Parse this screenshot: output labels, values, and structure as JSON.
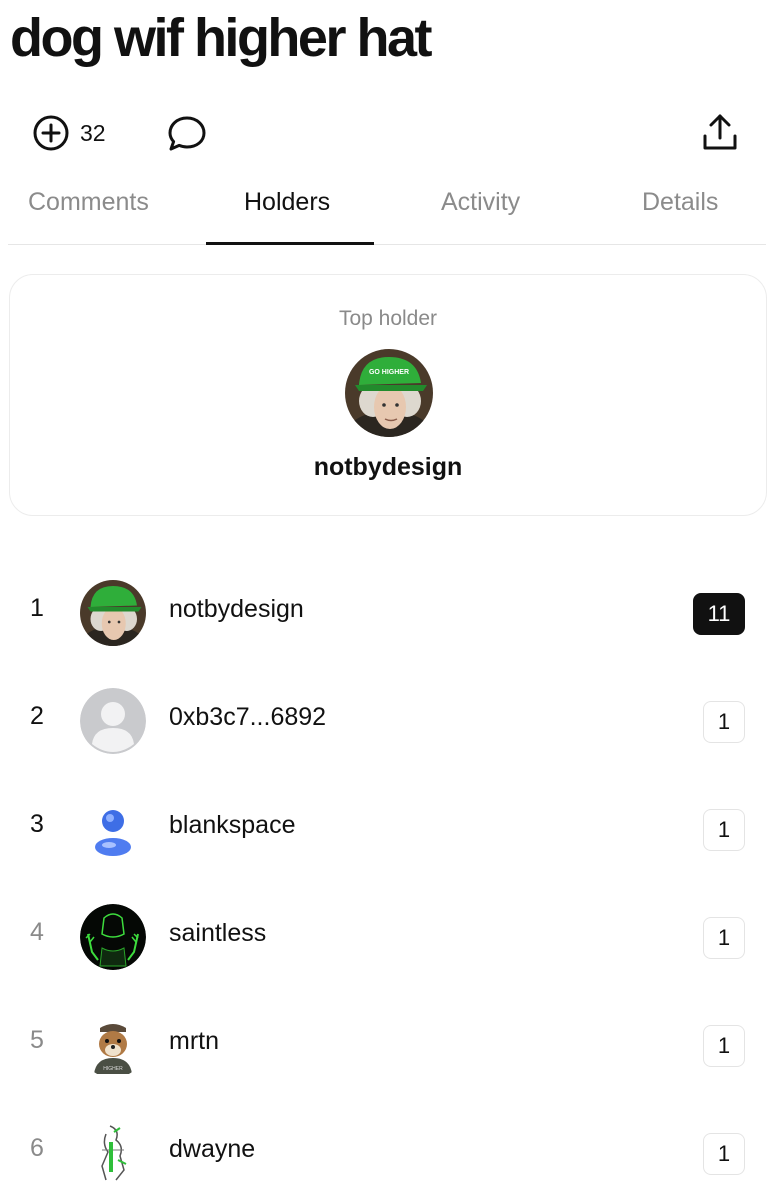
{
  "page": {
    "title": "dog wif higher hat"
  },
  "actions": {
    "mint_count": "32"
  },
  "tabs": [
    {
      "label": "Comments"
    },
    {
      "label": "Holders"
    },
    {
      "label": "Activity"
    },
    {
      "label": "Details"
    }
  ],
  "active_tab": "Holders",
  "top_holder": {
    "label": "Top holder",
    "name": "notbydesign",
    "avatar_caption": "GO HIGHER"
  },
  "holders": [
    {
      "rank": "1",
      "name": "notbydesign",
      "count": "11",
      "avatar": "green-cap-portrait"
    },
    {
      "rank": "2",
      "name": "0xb3c7...6892",
      "count": "1",
      "avatar": "default-gray-avatar"
    },
    {
      "rank": "3",
      "name": "blankspace",
      "count": "1",
      "avatar": "blue-person-avatar"
    },
    {
      "rank": "4",
      "name": "saintless",
      "count": "1",
      "avatar": "neon-green-figure"
    },
    {
      "rank": "5",
      "name": "mrtn",
      "count": "1",
      "avatar": "dog-with-cap"
    },
    {
      "rank": "6",
      "name": "dwayne",
      "count": "1",
      "avatar": "green-sketch-figure"
    }
  ],
  "colors": {
    "text": "#111111",
    "muted": "#8a8a8a",
    "border": "#e6e6e6",
    "cap_green": "#2fae3a"
  }
}
